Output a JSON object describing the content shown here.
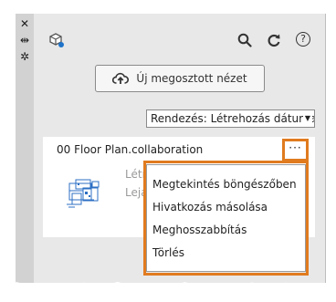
{
  "toolbar": {
    "strip_icons": [
      "close-icon",
      "collapse-icon",
      "settings-icon"
    ],
    "strip_glyphs": [
      "✕",
      "⇹",
      "✲"
    ],
    "app_icon": "cube-share-icon",
    "search_icon": "search-icon",
    "refresh_icon": "refresh-icon",
    "help_icon": "help-icon",
    "help_glyph": "?"
  },
  "new_view_button": {
    "label": "Új megosztott nézet",
    "icon": "cloud-upload-icon"
  },
  "sort": {
    "label": "Rendezés: Létrehozás dátuma",
    "caret": "▼"
  },
  "card": {
    "title": "00 Floor Plan.collaboration",
    "more_label": "···",
    "meta_line1": "Létr",
    "meta_line2": "Lejá"
  },
  "context_menu": {
    "items": [
      "Megtekintés böngészőben",
      "Hivatkozás másolása",
      "Meghosszabbítás",
      "Törlés"
    ]
  },
  "colors": {
    "highlight": "#e07b1f",
    "panel_bg": "#e8e8e8",
    "strip_bg": "#d2d2d2",
    "accent_blue": "#1f73c9"
  }
}
